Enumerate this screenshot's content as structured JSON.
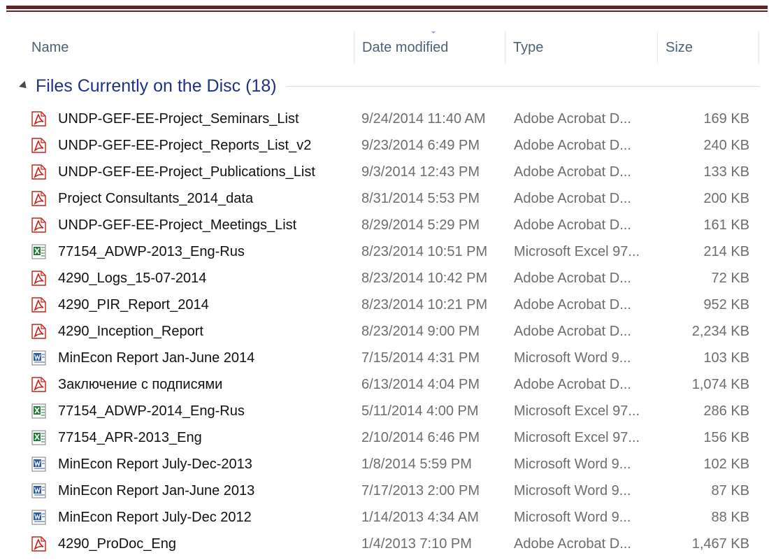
{
  "columns": {
    "name": "Name",
    "date_modified": "Date modified",
    "type": "Type",
    "size": "Size"
  },
  "sort": {
    "column": "date_modified",
    "direction": "descending"
  },
  "group": {
    "title": "Files Currently on the Disc (18)",
    "expanded": true
  },
  "colors": {
    "pdf_icon": "#c8201a",
    "excel_icon": "#1d7a32",
    "word_icon": "#2b5aad",
    "group_title": "#1e3287",
    "header_text": "#4c607a",
    "document_rule": "#622423"
  },
  "files": [
    {
      "icon": "pdf-icon",
      "name": "UNDP-GEF-EE-Project_Seminars_List",
      "date": "9/24/2014 11:40 AM",
      "type": "Adobe Acrobat D...",
      "size": "169 KB"
    },
    {
      "icon": "pdf-icon",
      "name": "UNDP-GEF-EE-Project_Reports_List_v2",
      "date": "9/23/2014 6:49 PM",
      "type": "Adobe Acrobat D...",
      "size": "240 KB"
    },
    {
      "icon": "pdf-icon",
      "name": "UNDP-GEF-EE-Project_Publications_List",
      "date": "9/3/2014 12:43 PM",
      "type": "Adobe Acrobat D...",
      "size": "133 KB"
    },
    {
      "icon": "pdf-icon",
      "name": "Project Consultants_2014_data",
      "date": "8/31/2014 5:53 PM",
      "type": "Adobe Acrobat D...",
      "size": "200 KB"
    },
    {
      "icon": "pdf-icon",
      "name": "UNDP-GEF-EE-Project_Meetings_List",
      "date": "8/29/2014 5:29 PM",
      "type": "Adobe Acrobat D...",
      "size": "161 KB"
    },
    {
      "icon": "excel-icon",
      "name": "77154_ADWP-2013_Eng-Rus",
      "date": "8/23/2014 10:51 PM",
      "type": "Microsoft Excel 97...",
      "size": "214 KB"
    },
    {
      "icon": "pdf-icon",
      "name": "4290_Logs_15-07-2014",
      "date": "8/23/2014 10:42 PM",
      "type": "Adobe Acrobat D...",
      "size": "72 KB"
    },
    {
      "icon": "pdf-icon",
      "name": "4290_PIR_Report_2014",
      "date": "8/23/2014 10:21 PM",
      "type": "Adobe Acrobat D...",
      "size": "952 KB"
    },
    {
      "icon": "pdf-icon",
      "name": "4290_Inception_Report",
      "date": "8/23/2014 9:00 PM",
      "type": "Adobe Acrobat D...",
      "size": "2,234 KB"
    },
    {
      "icon": "word-icon",
      "name": "MinEcon Report Jan-June 2014",
      "date": "7/15/2014 4:31 PM",
      "type": "Microsoft Word 9...",
      "size": "103 KB"
    },
    {
      "icon": "pdf-icon",
      "name": "Заключение с подписями",
      "date": "6/13/2014 4:04 PM",
      "type": "Adobe Acrobat D...",
      "size": "1,074 KB"
    },
    {
      "icon": "excel-icon",
      "name": "77154_ADWP-2014_Eng-Rus",
      "date": "5/11/2014 4:00 PM",
      "type": "Microsoft Excel 97...",
      "size": "286 KB"
    },
    {
      "icon": "excel-icon",
      "name": "77154_APR-2013_Eng",
      "date": "2/10/2014 6:46 PM",
      "type": "Microsoft Excel 97...",
      "size": "156 KB"
    },
    {
      "icon": "word-icon",
      "name": "MinEcon Report July-Dec-2013",
      "date": "1/8/2014 5:59 PM",
      "type": "Microsoft Word 9...",
      "size": "102 KB"
    },
    {
      "icon": "word-icon",
      "name": "MinEcon Report Jan-June 2013",
      "date": "7/17/2013 2:00 PM",
      "type": "Microsoft Word 9...",
      "size": "87 KB"
    },
    {
      "icon": "word-icon",
      "name": "MinEcon Report July-Dec 2012",
      "date": "1/14/2013 4:34 AM",
      "type": "Microsoft Word 9...",
      "size": "88 KB"
    },
    {
      "icon": "pdf-icon",
      "name": "4290_ProDoc_Eng",
      "date": "1/4/2013 7:10 PM",
      "type": "Adobe Acrobat D...",
      "size": "1,467 KB"
    }
  ]
}
